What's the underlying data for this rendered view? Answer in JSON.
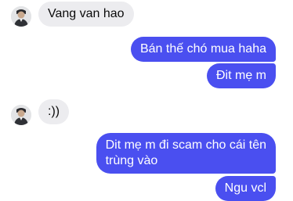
{
  "contact": {
    "avatar_icon": "person-avatar-icon"
  },
  "colors": {
    "outgoing_bubble": "#4a4ff0",
    "incoming_bubble": "#ececef",
    "background": "#ffffff"
  },
  "messages": [
    {
      "direction": "incoming",
      "text": "Vang van hao"
    },
    {
      "direction": "outgoing",
      "text": "Bán thế chó mua haha"
    },
    {
      "direction": "outgoing",
      "text": "Đit mẹ m"
    },
    {
      "direction": "incoming",
      "text": ":))"
    },
    {
      "direction": "outgoing",
      "lines": [
        "Dit mẹ m đi scam cho cái tên",
        "trùng vào"
      ]
    },
    {
      "direction": "outgoing",
      "text": "Ngu vcl"
    }
  ]
}
